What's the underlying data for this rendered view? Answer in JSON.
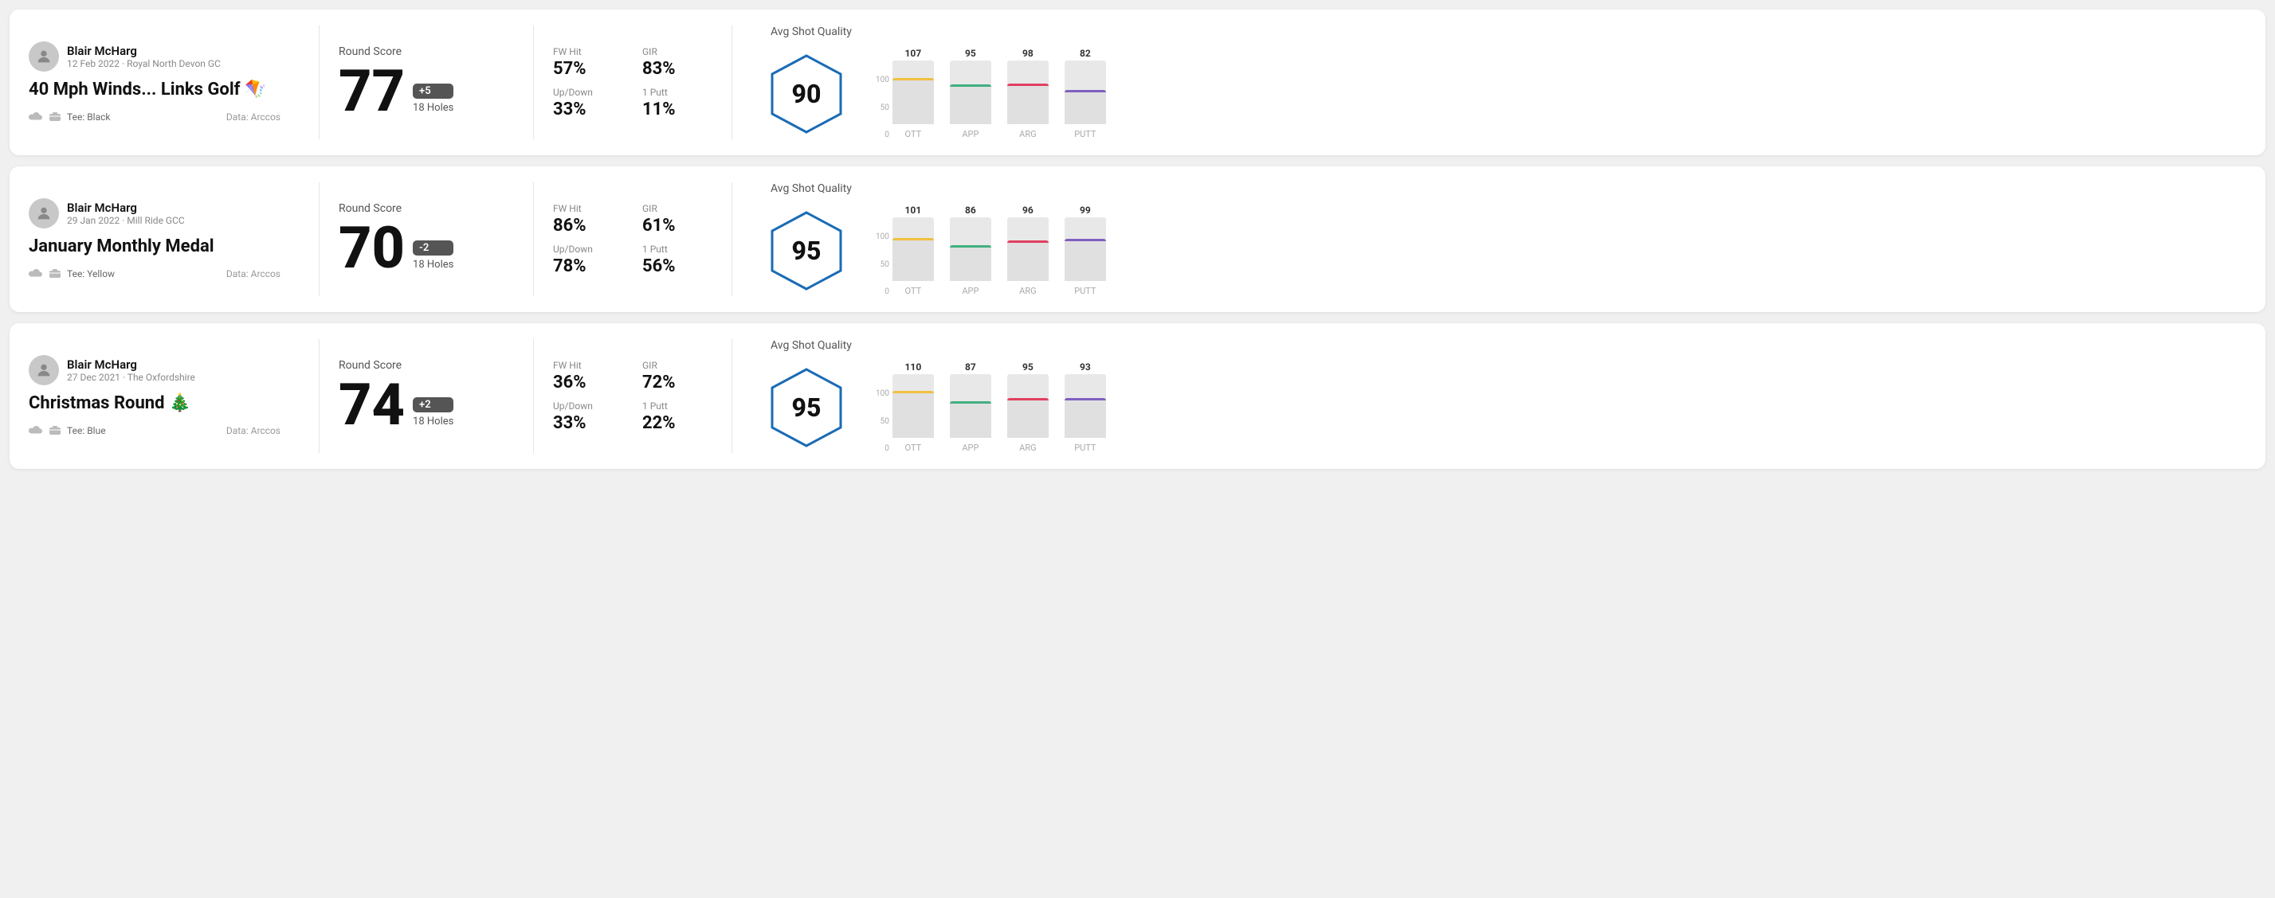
{
  "rounds": [
    {
      "id": "round-1",
      "user": {
        "name": "Blair McHarg",
        "date": "12 Feb 2022 · Royal North Devon GC"
      },
      "title": "40 Mph Winds... Links Golf 🪁",
      "tee": "Black",
      "data_source": "Data: Arccos",
      "score": {
        "label": "Round Score",
        "value": "77",
        "badge": "+5",
        "holes": "18 Holes"
      },
      "stats": {
        "fw_hit_label": "FW Hit",
        "fw_hit_value": "57%",
        "gir_label": "GIR",
        "gir_value": "83%",
        "updown_label": "Up/Down",
        "updown_value": "33%",
        "oneputt_label": "1 Putt",
        "oneputt_value": "11%"
      },
      "quality": {
        "label": "Avg Shot Quality",
        "score": "90",
        "bars": [
          {
            "label": "OTT",
            "value": 107,
            "color": "#f0c040",
            "bar_pct": 72
          },
          {
            "label": "APP",
            "value": 95,
            "color": "#40b080",
            "bar_pct": 62
          },
          {
            "label": "ARG",
            "value": 98,
            "color": "#e04060",
            "bar_pct": 64
          },
          {
            "label": "PUTT",
            "value": 82,
            "color": "#8060c0",
            "bar_pct": 54
          }
        ]
      }
    },
    {
      "id": "round-2",
      "user": {
        "name": "Blair McHarg",
        "date": "29 Jan 2022 · Mill Ride GCC"
      },
      "title": "January Monthly Medal",
      "tee": "Yellow",
      "data_source": "Data: Arccos",
      "score": {
        "label": "Round Score",
        "value": "70",
        "badge": "-2",
        "holes": "18 Holes"
      },
      "stats": {
        "fw_hit_label": "FW Hit",
        "fw_hit_value": "86%",
        "gir_label": "GIR",
        "gir_value": "61%",
        "updown_label": "Up/Down",
        "updown_value": "78%",
        "oneputt_label": "1 Putt",
        "oneputt_value": "56%"
      },
      "quality": {
        "label": "Avg Shot Quality",
        "score": "95",
        "bars": [
          {
            "label": "OTT",
            "value": 101,
            "color": "#f0c040",
            "bar_pct": 68
          },
          {
            "label": "APP",
            "value": 86,
            "color": "#40b080",
            "bar_pct": 56
          },
          {
            "label": "ARG",
            "value": 96,
            "color": "#e04060",
            "bar_pct": 64
          },
          {
            "label": "PUTT",
            "value": 99,
            "color": "#8060c0",
            "bar_pct": 66
          }
        ]
      }
    },
    {
      "id": "round-3",
      "user": {
        "name": "Blair McHarg",
        "date": "27 Dec 2021 · The Oxfordshire"
      },
      "title": "Christmas Round 🎄",
      "tee": "Blue",
      "data_source": "Data: Arccos",
      "score": {
        "label": "Round Score",
        "value": "74",
        "badge": "+2",
        "holes": "18 Holes"
      },
      "stats": {
        "fw_hit_label": "FW Hit",
        "fw_hit_value": "36%",
        "gir_label": "GIR",
        "gir_value": "72%",
        "updown_label": "Up/Down",
        "updown_value": "33%",
        "oneputt_label": "1 Putt",
        "oneputt_value": "22%"
      },
      "quality": {
        "label": "Avg Shot Quality",
        "score": "95",
        "bars": [
          {
            "label": "OTT",
            "value": 110,
            "color": "#f0c040",
            "bar_pct": 74
          },
          {
            "label": "APP",
            "value": 87,
            "color": "#40b080",
            "bar_pct": 57
          },
          {
            "label": "ARG",
            "value": 95,
            "color": "#e04060",
            "bar_pct": 63
          },
          {
            "label": "PUTT",
            "value": 93,
            "color": "#8060c0",
            "bar_pct": 62
          }
        ]
      }
    }
  ],
  "axis": {
    "top": "100",
    "mid": "50",
    "bot": "0"
  }
}
